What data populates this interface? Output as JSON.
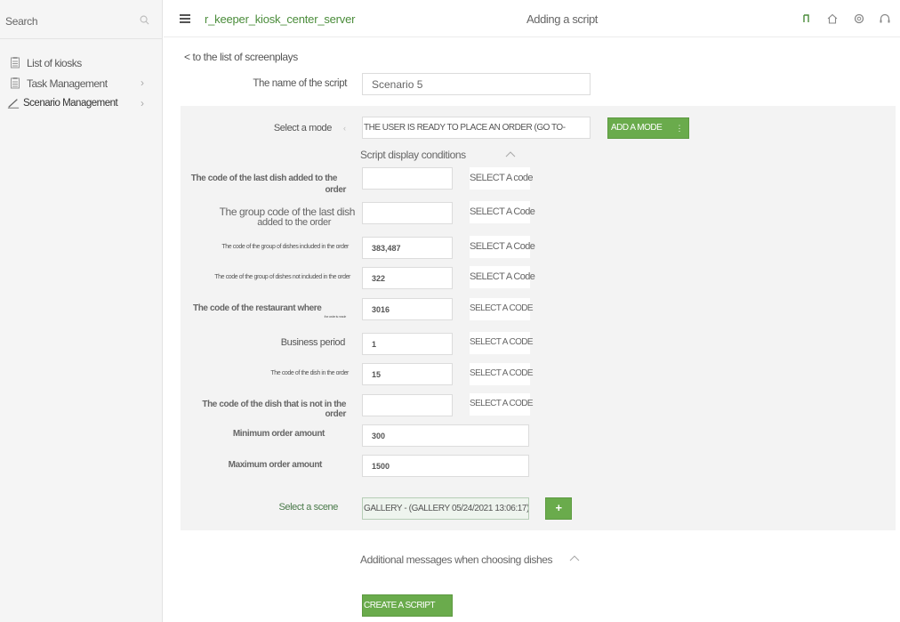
{
  "sidebar": {
    "search_label": "Search",
    "items": [
      {
        "label": "List of kiosks",
        "icon": "clipboard-icon"
      },
      {
        "label": "Task Management",
        "icon": "clipboard-icon"
      },
      {
        "label": "Scenario Management",
        "icon": "pencil-icon"
      }
    ]
  },
  "topbar": {
    "app_name": "r_keeper_kiosk_center_server",
    "page_title": "Adding a script",
    "icons": [
      "user-icon",
      "home-icon",
      "gear-icon",
      "headset-icon"
    ]
  },
  "main": {
    "back_link": "< to the list of screenplays",
    "script_name_label": "The name of the script",
    "script_name_value": "Scenario 5",
    "mode_label": "Select a mode",
    "mode_value": "THE USER IS READY TO PLACE AN ORDER (GO TO-",
    "add_mode_button": "ADD A MODE",
    "conditions_header": "Script display conditions",
    "conditions": [
      {
        "label_line1": "The code of the last dish added to the",
        "label_line2": "order",
        "value": "",
        "select": "SELECT A code"
      },
      {
        "label_line1": "The group code of the last dish",
        "label_line2": "added to the order",
        "value": "",
        "select": "SELECT A Code"
      },
      {
        "label_line1": "The code of the group of dishes included in the order",
        "label_line2": "",
        "value": "383,487",
        "select": "SELECT A Code"
      },
      {
        "label_line1": "The code of the group of dishes not included in the order",
        "label_line2": "",
        "value": "322",
        "select": "SELECT A Code"
      },
      {
        "label_line1": "The code of the restaurant where",
        "label_line2": "the order is made",
        "value": "3016",
        "select": "SELECT A CODE"
      },
      {
        "label_line1": "Business period",
        "label_line2": "",
        "value": "1",
        "select": "SELECT A CODE"
      },
      {
        "label_line1": "The code of the dish in the order",
        "label_line2": "",
        "value": "15",
        "select": "SELECT A CODE"
      },
      {
        "label_line1": "The code of the dish that is not in the order",
        "label_line2": "",
        "value": "",
        "select": "SELECT A CODE"
      }
    ],
    "min_amount_label": "Minimum order amount",
    "min_amount_value": "300",
    "max_amount_label": "Maximum order amount",
    "max_amount_value": "1500",
    "scene_label": "Select a scene",
    "scene_value": "GALLERY - (GALLERY 05/24/2021 13:06:17)-",
    "add_scene_button": "+",
    "additional_header": "Additional messages when choosing dishes",
    "create_button": "CREATE A SCRIPT"
  },
  "colors": {
    "accent_green": "#6aab4c",
    "app_name_green": "#4a8c3a",
    "panel_grey": "#f3f3f3"
  }
}
